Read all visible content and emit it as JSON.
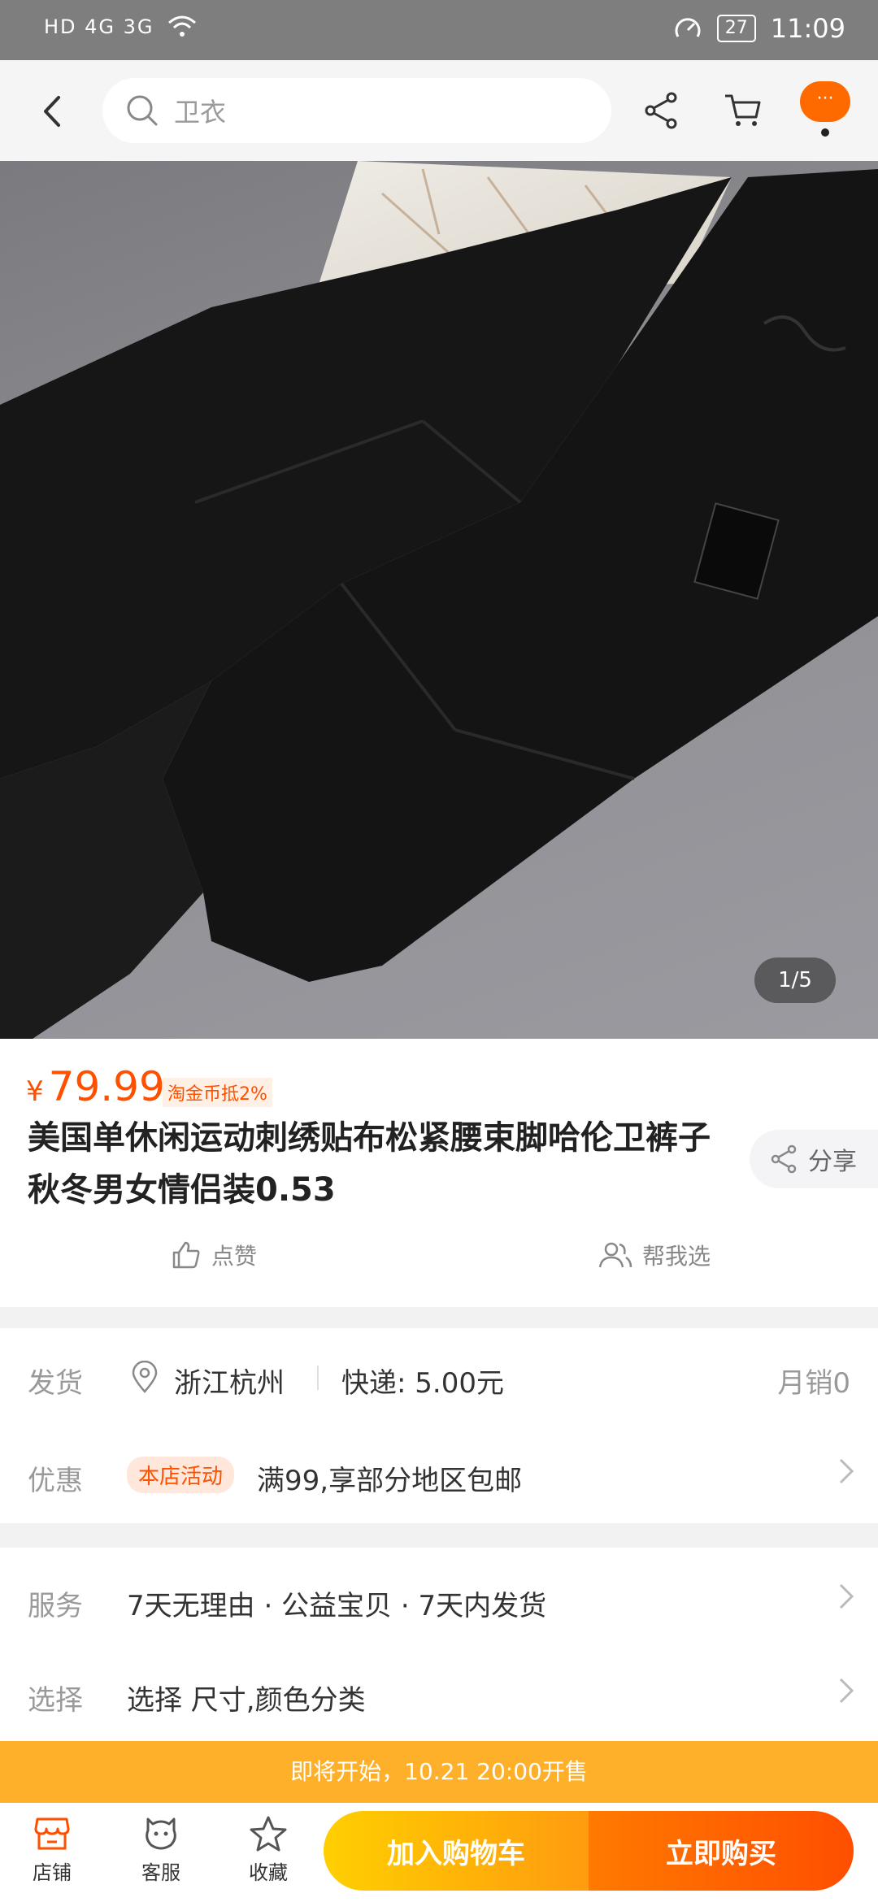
{
  "status_bar": {
    "network": "HD 4G 3G",
    "battery": "27",
    "time": "11:09"
  },
  "search": {
    "placeholder": "卫衣"
  },
  "top_bar": {
    "more_label": "···"
  },
  "hero": {
    "counter": "1/5"
  },
  "product": {
    "currency": "¥",
    "price": "79.99",
    "price_badge": "淘金币抵2%",
    "title": "美国单休闲运动刺绣贴布松紧腰束脚哈伦卫裤子秋冬男女情侣装0.53",
    "share_label": "分享",
    "like_label": "点赞",
    "help_choose_label": "帮我选"
  },
  "shipping": {
    "label": "发货",
    "location": "浙江杭州",
    "express": "快递: 5.00元",
    "monthly_sales": "月销0"
  },
  "promo": {
    "label": "优惠",
    "tag": "本店活动",
    "text": "满99,享部分地区包邮"
  },
  "service": {
    "label": "服务",
    "text": "7天无理由 · 公益宝贝 · 7天内发货"
  },
  "select": {
    "label": "选择",
    "text": "选择 尺寸,颜色分类"
  },
  "notice": {
    "text": "即将开始，10.21 20:00开售"
  },
  "bottom_bar": {
    "shop": "店铺",
    "service": "客服",
    "favorite": "收藏",
    "add_cart": "加入购物车",
    "buy_now": "立即购买"
  },
  "colors": {
    "accent": "#ff5000",
    "notice": "#ffb02a"
  }
}
